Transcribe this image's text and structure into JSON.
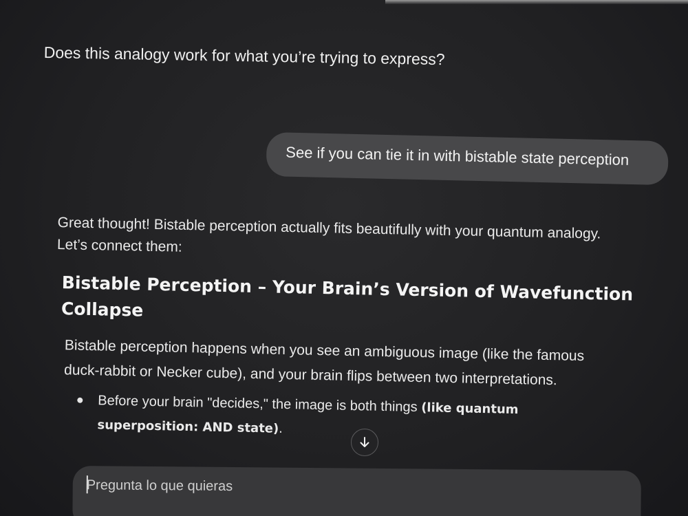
{
  "conversation": {
    "previous_message_tail": "Does this analogy work for what you’re trying to express?",
    "user_message": "See if you can tie it in with bistable state perception",
    "assistant": {
      "intro": "Great thought! Bistable perception actually fits beautifully with your quantum analogy. Let’s connect them:",
      "heading": "Bistable Perception – Your Brain’s Version of Wavefunction Collapse",
      "paragraph": "Bistable perception happens when you see an ambiguous image (like the famous duck-rabbit or Necker cube), and your brain flips between two interpretations.",
      "bullets": [
        {
          "text": "Before your brain \"decides,\" the image is both things ",
          "bold": "(like quantum superposition: AND state)",
          "end": "."
        }
      ]
    }
  },
  "composer": {
    "placeholder": "Pregunta lo que quieras"
  },
  "icons": {
    "scroll_down": "arrow-down-icon"
  }
}
